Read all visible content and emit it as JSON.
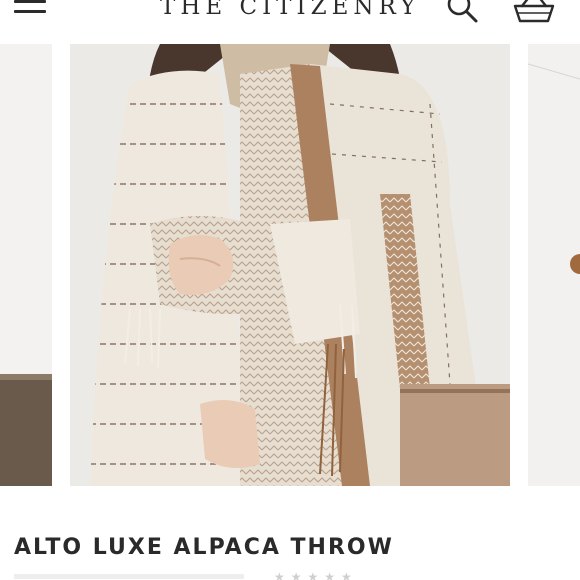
{
  "header": {
    "brand": "THE CITIZENRY",
    "menu_icon": "hamburger-menu-icon",
    "search_icon": "search-icon",
    "cart_icon": "basket-icon"
  },
  "carousel": {
    "slide_count": 7,
    "active_index": 6,
    "main_image": "woman wrapped in striped alpaca throw"
  },
  "product": {
    "title": "ALTO LUXE ALPACA THROW"
  },
  "colors": {
    "text": "#2b2b2b",
    "throw_cream": "#e6ddd0",
    "throw_brown": "#a57a58"
  }
}
